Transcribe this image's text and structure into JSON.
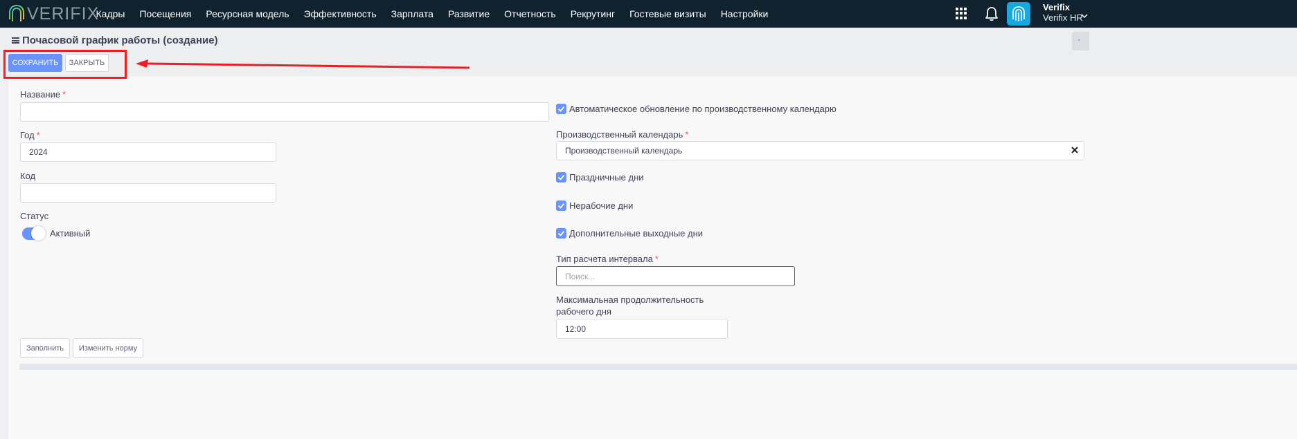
{
  "app": {
    "logo_text": "VERIFIX",
    "nav": [
      "Кадры",
      "Посещения",
      "Ресурсная модель",
      "Эффективность",
      "Зарплата",
      "Развитие",
      "Отчетность",
      "Рекрутинг",
      "Гостевые визиты",
      "Настройки"
    ],
    "user": {
      "name": "Verifix",
      "company": "Verifix HR"
    },
    "icons": {
      "apps": "apps-grid-icon",
      "notifications": "bell-icon",
      "avatar": "fingerprint-icon"
    }
  },
  "page": {
    "title": "Почасовой график работы (создание)"
  },
  "toolbar": {
    "save_label": "СОХРАНИТЬ",
    "close_label": "ЗАКРЫТЬ"
  },
  "form": {
    "name": {
      "label": "Название",
      "value": ""
    },
    "year": {
      "label": "Год",
      "value": "2024"
    },
    "code": {
      "label": "Код",
      "value": ""
    },
    "status": {
      "label": "Статус",
      "value_label": "Активный",
      "on": true
    },
    "auto_update": {
      "label": "Автоматическое обновление по производственному календарю",
      "checked": true
    },
    "production_calendar": {
      "label": "Производственный календарь",
      "value": "Производственный календарь"
    },
    "holidays": {
      "label": "Праздничные дни",
      "checked": true
    },
    "non_working": {
      "label": "Нерабочие дни",
      "checked": true
    },
    "extra_days_off": {
      "label": "Дополнительные выходные дни",
      "checked": true
    },
    "interval_type": {
      "label": "Тип расчета интервала",
      "placeholder": "Поиск...",
      "value": ""
    },
    "max_duration": {
      "label_line1": "Максимальная продолжительность",
      "label_line2": "рабочего дня",
      "value": "12:00"
    }
  },
  "actions": {
    "fill_label": "Заполнить",
    "change_norm_label": "Изменить норму"
  },
  "colors": {
    "navbar": "#10222e",
    "primary": "#6993ff",
    "required": "#f64e60",
    "annotation": "#ef1c24"
  }
}
